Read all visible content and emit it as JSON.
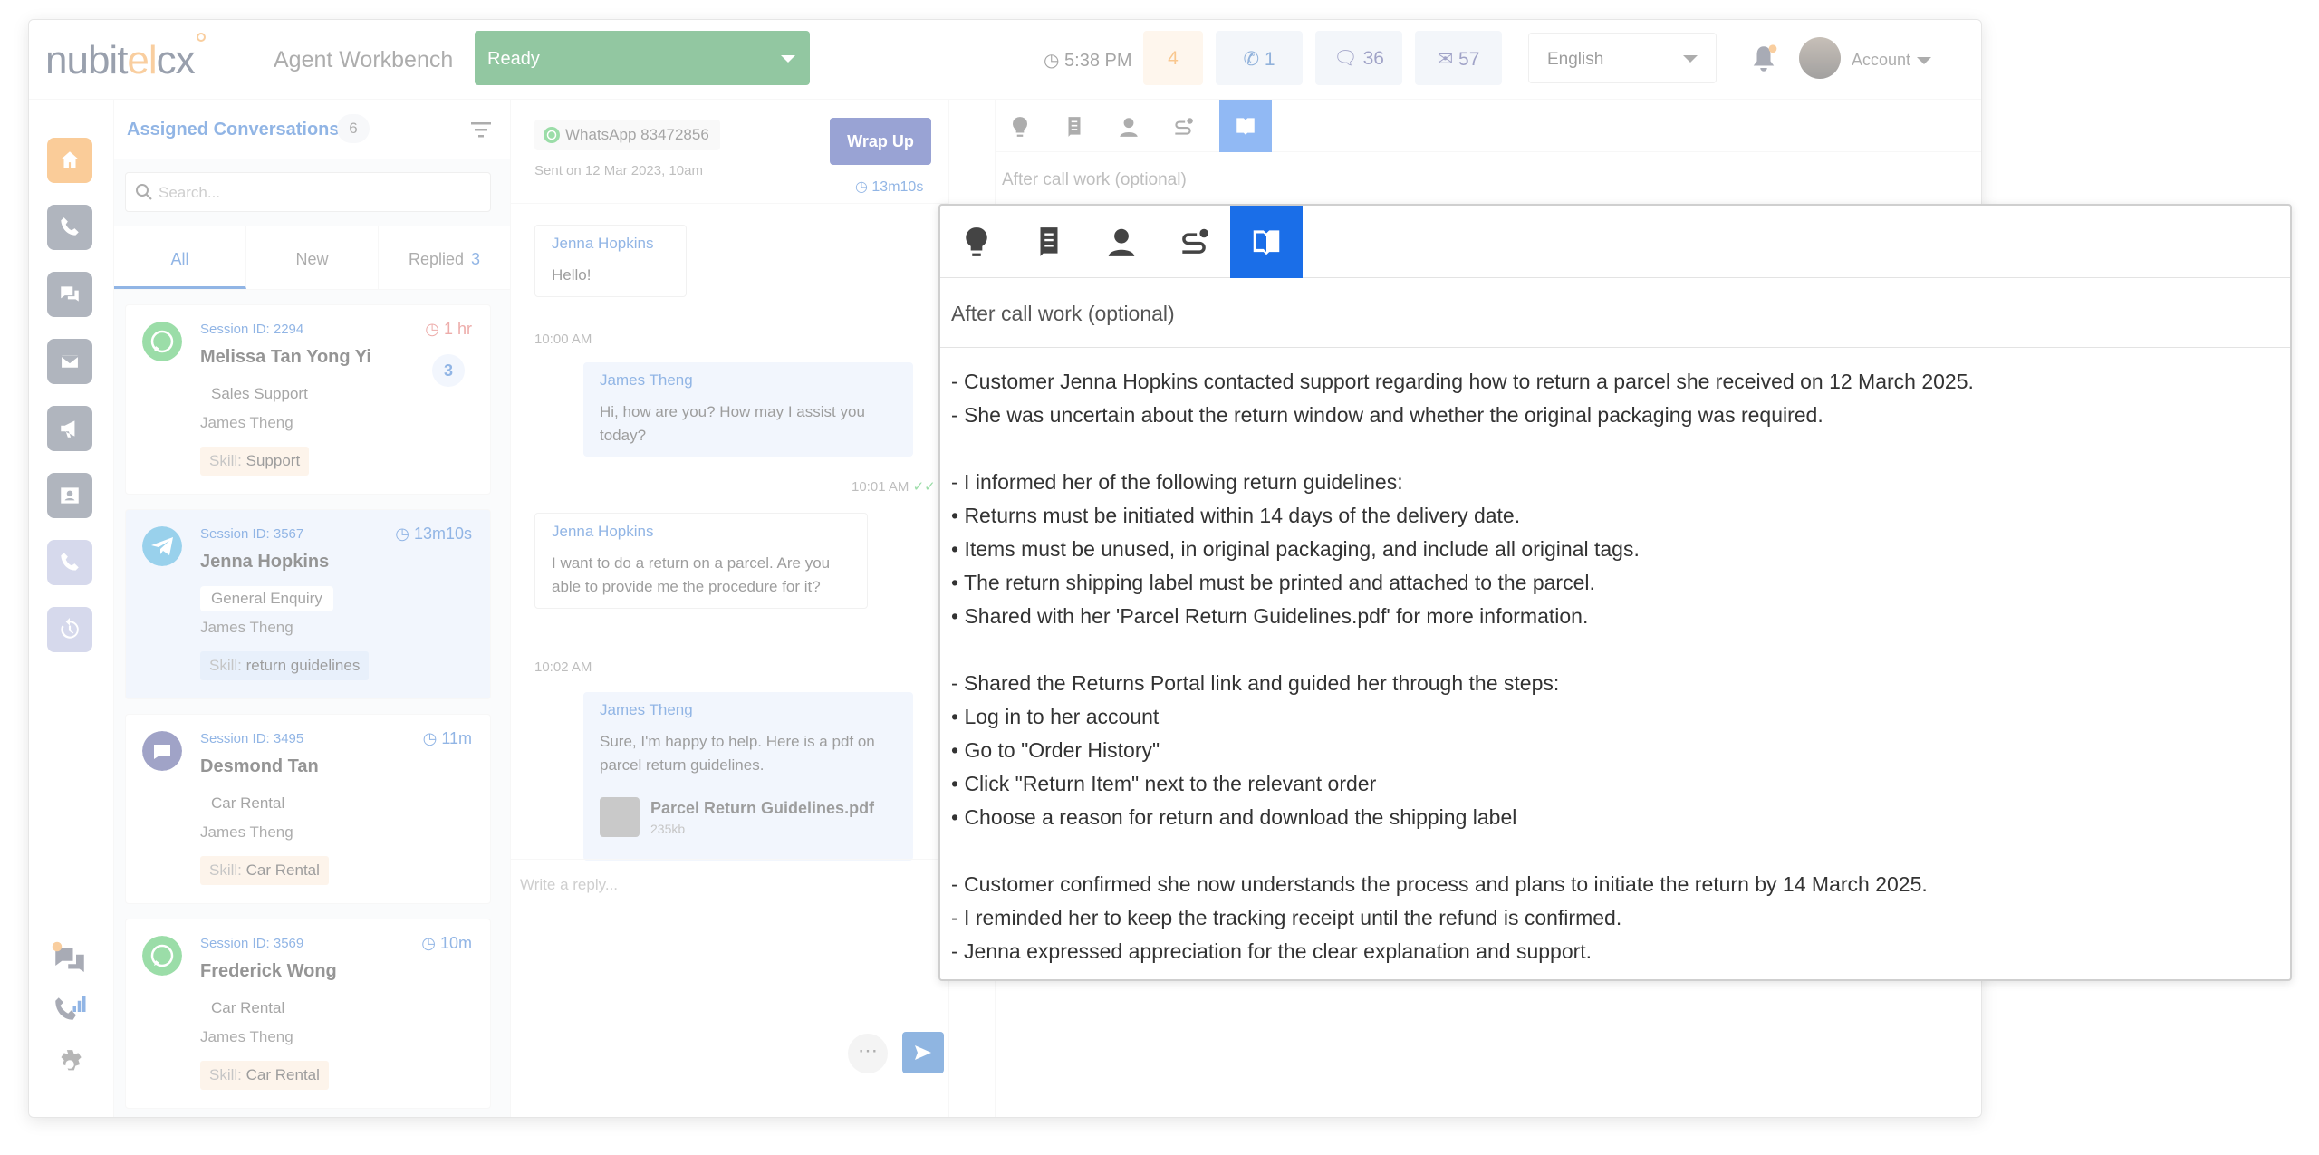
{
  "app": {
    "logo": {
      "part1": "nubit",
      "part2": "el",
      "part3": "cx"
    },
    "title": "Agent Workbench"
  },
  "topbar": {
    "status": "Ready",
    "clock": "5:38 PM",
    "stats": {
      "queue": "4",
      "calls": "1",
      "chats": "36",
      "emails": "57"
    },
    "language": "English",
    "account": "Account"
  },
  "conversations": {
    "title": "Assigned Conversations",
    "count": "6",
    "search_placeholder": "Search...",
    "tabs": {
      "all": "All",
      "new": "New",
      "replied": "Replied",
      "replied_count": "3"
    },
    "items": [
      {
        "session": "Session ID: 2294",
        "timer": "1 hr",
        "name": "Melissa Tan Yong Yi",
        "dept": "Sales Support",
        "agent": "James Theng",
        "skill_label": "Skill:",
        "skill": "Support",
        "unread": "3",
        "channel": "whatsapp"
      },
      {
        "session": "Session ID: 3567",
        "timer": "13m10s",
        "name": "Jenna Hopkins",
        "dept": "General Enquiry",
        "agent": "James Theng",
        "skill_label": "Skill:",
        "skill": "return guidelines",
        "channel": "telegram"
      },
      {
        "session": "Session ID: 3495",
        "timer": "11m",
        "name": "Desmond Tan",
        "dept": "Car Rental",
        "agent": "James Theng",
        "skill_label": "Skill:",
        "skill": "Car Rental",
        "channel": "webchat"
      },
      {
        "session": "Session ID: 3569",
        "timer": "10m",
        "name": "Frederick Wong",
        "dept": "Car Rental",
        "agent": "James Theng",
        "skill_label": "Skill:",
        "skill": "Car Rental",
        "channel": "whatsapp"
      }
    ]
  },
  "chat": {
    "channel": "WhatsApp 83472856",
    "sent_on": "Sent on 12 Mar 2023, 10am",
    "wrap_up": "Wrap Up",
    "timer": "13m10s",
    "messages": [
      {
        "sender": "Jenna Hopkins",
        "text": "Hello!",
        "time": "10:00 AM"
      },
      {
        "sender": "James Theng",
        "text": "Hi, how are you? How may I assist you today?",
        "time": "10:01 AM"
      },
      {
        "sender": "Jenna Hopkins",
        "text": "I want to do a return on a parcel. Are you able to provide me the procedure for it?",
        "time": "10:02 AM"
      },
      {
        "sender": "James Theng",
        "text": "Sure, I'm happy to help. Here is a pdf on parcel return guidelines."
      }
    ],
    "attachment": {
      "name": "Parcel Return Guidelines.pdf",
      "size": "235kb"
    },
    "reply_placeholder": "Write a reply...",
    "more": "⋯"
  },
  "acw": {
    "title": "After call work (optional)",
    "notes": [
      "- Customer Jenna Hopkins contacted support regarding how to return a parcel she received on 12 March 2025.",
      "- She was uncertain about the return window and whether the original packaging was required.",
      "",
      "- I informed her of the following return guidelines:",
      "• Returns must be initiated within 14 days of the delivery date.",
      "• Items must be unused, in original packaging, and include all original tags.",
      "• The return shipping label must be printed and attached to the parcel.",
      "• Shared with her 'Parcel Return Guidelines.pdf' for more information.",
      "",
      "- Shared the Returns Portal link and guided her through the steps:",
      "• Log in to her account",
      "• Go to \"Order History\"",
      "• Click \"Return Item\" next to the relevant order",
      "• Choose a reason for return and download the shipping label",
      "",
      "- Customer confirmed she now understands the process and plans to initiate the return by 14 March 2025.",
      "- I reminded her to keep the tracking receipt until the refund is confirmed.",
      "- Jenna expressed appreciation for the clear explanation and support."
    ]
  },
  "colors": {
    "primary": "#1a6ee8",
    "ready": "#1d8a3b",
    "nav": "#5a6478",
    "accent": "#f29a38",
    "wrapup": "#2b3fa5"
  },
  "icons": {
    "toolbar": [
      "lightbulb-icon",
      "script-icon",
      "contact-icon",
      "route-icon",
      "book-icon"
    ]
  }
}
